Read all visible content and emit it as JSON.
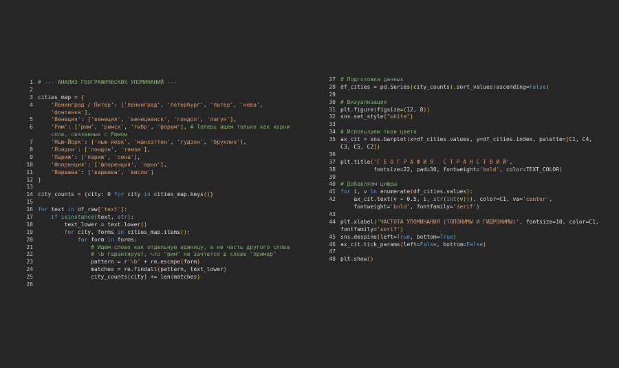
{
  "editor": {
    "left_pane": [
      {
        "n": "1",
        "segs": [
          [
            "c",
            "# --- АНАЛИЗ ГЕОГРАФИЧЕСКИХ УПОМИНАНИЙ ---"
          ]
        ]
      },
      {
        "n": "2",
        "segs": []
      },
      {
        "n": "3",
        "segs": [
          [
            "t",
            "cities_map = "
          ],
          [
            "p",
            "{"
          ]
        ]
      },
      {
        "n": "4",
        "segs": [
          [
            "t",
            "    "
          ],
          [
            "s",
            "'Ленинград / Питер'"
          ],
          [
            "t",
            ": "
          ],
          [
            "p",
            "["
          ],
          [
            "s",
            "'ленинград'"
          ],
          [
            "t",
            ", "
          ],
          [
            "s",
            "'петербург'"
          ],
          [
            "t",
            ", "
          ],
          [
            "s",
            "'питер'"
          ],
          [
            "t",
            ", "
          ],
          [
            "s",
            "'нева'"
          ],
          [
            "t",
            ","
          ]
        ]
      },
      {
        "n": "",
        "segs": [
          [
            "t",
            "    "
          ],
          [
            "s",
            "'фонтанка'"
          ],
          [
            "p",
            "]"
          ],
          [
            "t",
            ","
          ]
        ]
      },
      {
        "n": "5",
        "segs": [
          [
            "t",
            "    "
          ],
          [
            "s",
            "'Венеция'"
          ],
          [
            "t",
            ": "
          ],
          [
            "p",
            "["
          ],
          [
            "s",
            "'венеция'"
          ],
          [
            "t",
            ", "
          ],
          [
            "s",
            "'венецианск'"
          ],
          [
            "t",
            ", "
          ],
          [
            "s",
            "'гондол'"
          ],
          [
            "t",
            ", "
          ],
          [
            "s",
            "'лагун'"
          ],
          [
            "p",
            "]"
          ],
          [
            "t",
            ","
          ]
        ]
      },
      {
        "n": "6",
        "segs": [
          [
            "t",
            "    "
          ],
          [
            "s",
            "'Рим'"
          ],
          [
            "t",
            ": "
          ],
          [
            "p",
            "["
          ],
          [
            "s",
            "'рим'"
          ],
          [
            "t",
            ", "
          ],
          [
            "s",
            "'римск'"
          ],
          [
            "t",
            ", "
          ],
          [
            "s",
            "'тибр'"
          ],
          [
            "t",
            ", "
          ],
          [
            "s",
            "'форум'"
          ],
          [
            "p",
            "]"
          ],
          [
            "t",
            ", "
          ],
          [
            "c",
            "# Теперь ищем только как корни"
          ]
        ]
      },
      {
        "n": "",
        "segs": [
          [
            "t",
            "    "
          ],
          [
            "c",
            "слов, связанных с Римом"
          ]
        ]
      },
      {
        "n": "7",
        "segs": [
          [
            "t",
            "    "
          ],
          [
            "s",
            "'Нью-Йорк'"
          ],
          [
            "t",
            ": "
          ],
          [
            "p",
            "["
          ],
          [
            "s",
            "'нью-йорк'"
          ],
          [
            "t",
            ", "
          ],
          [
            "s",
            "'манхэттен'"
          ],
          [
            "t",
            ", "
          ],
          [
            "s",
            "'гудзон'"
          ],
          [
            "t",
            ", "
          ],
          [
            "s",
            "'бруклин'"
          ],
          [
            "p",
            "]"
          ],
          [
            "t",
            ","
          ]
        ]
      },
      {
        "n": "8",
        "segs": [
          [
            "t",
            "    "
          ],
          [
            "s",
            "'Лондон'"
          ],
          [
            "t",
            ": "
          ],
          [
            "p",
            "["
          ],
          [
            "s",
            "'лондон'"
          ],
          [
            "t",
            ", "
          ],
          [
            "s",
            "'темза'"
          ],
          [
            "p",
            "]"
          ],
          [
            "t",
            ","
          ]
        ]
      },
      {
        "n": "9",
        "segs": [
          [
            "t",
            "    "
          ],
          [
            "s",
            "'Париж'"
          ],
          [
            "t",
            ": "
          ],
          [
            "p",
            "["
          ],
          [
            "s",
            "'париж'"
          ],
          [
            "t",
            ", "
          ],
          [
            "s",
            "'сена'"
          ],
          [
            "p",
            "]"
          ],
          [
            "t",
            ","
          ]
        ]
      },
      {
        "n": "10",
        "segs": [
          [
            "t",
            "    "
          ],
          [
            "s",
            "'Флоренция'"
          ],
          [
            "t",
            ": "
          ],
          [
            "p",
            "["
          ],
          [
            "s",
            "'флоренция'"
          ],
          [
            "t",
            ", "
          ],
          [
            "s",
            "'арно'"
          ],
          [
            "p",
            "]"
          ],
          [
            "t",
            ","
          ]
        ]
      },
      {
        "n": "11",
        "segs": [
          [
            "t",
            "    "
          ],
          [
            "s",
            "'Варшава'"
          ],
          [
            "t",
            ": "
          ],
          [
            "p",
            "["
          ],
          [
            "s",
            "'варшава'"
          ],
          [
            "t",
            ", "
          ],
          [
            "s",
            "'висла'"
          ],
          [
            "p",
            "]"
          ]
        ]
      },
      {
        "n": "12",
        "segs": [
          [
            "p",
            "}"
          ]
        ]
      },
      {
        "n": "13",
        "segs": []
      },
      {
        "n": "14",
        "segs": [
          [
            "t",
            "city_counts = "
          ],
          [
            "p",
            "{"
          ],
          [
            "t",
            "city: 0 "
          ],
          [
            "k",
            "for"
          ],
          [
            "t",
            " city "
          ],
          [
            "k",
            "in"
          ],
          [
            "t",
            " cities_map.keys"
          ],
          [
            "p",
            "()"
          ],
          [
            "p",
            "}"
          ]
        ]
      },
      {
        "n": "15",
        "segs": []
      },
      {
        "n": "16",
        "segs": [
          [
            "k",
            "for"
          ],
          [
            "t",
            " text "
          ],
          [
            "k",
            "in"
          ],
          [
            "t",
            " df_raw"
          ],
          [
            "p",
            "["
          ],
          [
            "s",
            "'text'"
          ],
          [
            "p",
            "]"
          ],
          [
            "t",
            ":"
          ]
        ]
      },
      {
        "n": "17",
        "segs": [
          [
            "t",
            "    "
          ],
          [
            "k",
            "if"
          ],
          [
            "t",
            " "
          ],
          [
            "b",
            "isinstance"
          ],
          [
            "p",
            "("
          ],
          [
            "t",
            "text, "
          ],
          [
            "b",
            "str"
          ],
          [
            "p",
            ")"
          ],
          [
            "t",
            ":"
          ]
        ]
      },
      {
        "n": "18",
        "segs": [
          [
            "t",
            "        text_lower = text.lower"
          ],
          [
            "p",
            "()"
          ]
        ]
      },
      {
        "n": "19",
        "segs": [
          [
            "t",
            "        "
          ],
          [
            "k",
            "for"
          ],
          [
            "t",
            " city, forms "
          ],
          [
            "k",
            "in"
          ],
          [
            "t",
            " cities_map.items"
          ],
          [
            "p",
            "()"
          ],
          [
            "t",
            ":"
          ]
        ]
      },
      {
        "n": "20",
        "segs": [
          [
            "t",
            "            "
          ],
          [
            "k",
            "for"
          ],
          [
            "t",
            " form "
          ],
          [
            "k",
            "in"
          ],
          [
            "t",
            " forms:"
          ]
        ]
      },
      {
        "n": "21",
        "segs": [
          [
            "t",
            "                "
          ],
          [
            "c",
            "# Ищем слово как отдельную единицу, а не часть другого слова"
          ]
        ]
      },
      {
        "n": "22",
        "segs": [
          [
            "t",
            "                "
          ],
          [
            "c",
            "# \\b гарантирует, что \"рим\" не зачтется в слове \"пример\""
          ]
        ]
      },
      {
        "n": "23",
        "segs": [
          [
            "t",
            "                pattern = r"
          ],
          [
            "s",
            "'\\b'"
          ],
          [
            "t",
            " + re.escape"
          ],
          [
            "p",
            "("
          ],
          [
            "t",
            "form"
          ],
          [
            "p",
            ")"
          ]
        ]
      },
      {
        "n": "24",
        "segs": [
          [
            "t",
            "                matches = re.findall"
          ],
          [
            "p",
            "("
          ],
          [
            "t",
            "pattern, text_lower"
          ],
          [
            "p",
            ")"
          ]
        ]
      },
      {
        "n": "25",
        "segs": [
          [
            "t",
            "                city_counts"
          ],
          [
            "p",
            "["
          ],
          [
            "t",
            "city"
          ],
          [
            "p",
            "]"
          ],
          [
            "t",
            " += "
          ],
          [
            "t",
            "len"
          ],
          [
            "p",
            "("
          ],
          [
            "t",
            "matches"
          ],
          [
            "p",
            ")"
          ]
        ]
      },
      {
        "n": "26",
        "segs": []
      }
    ],
    "right_pane": [
      {
        "n": "27",
        "segs": [
          [
            "c",
            "# Подготовка данных"
          ]
        ]
      },
      {
        "n": "28",
        "segs": [
          [
            "t",
            "df_cities = pd.Series"
          ],
          [
            "p",
            "("
          ],
          [
            "t",
            "city_counts"
          ],
          [
            "p",
            ")"
          ],
          [
            "t",
            ".sort_values"
          ],
          [
            "p",
            "("
          ],
          [
            "t",
            "ascending="
          ],
          [
            "v",
            "False"
          ],
          [
            "p",
            ")"
          ]
        ]
      },
      {
        "n": "29",
        "segs": []
      },
      {
        "n": "30",
        "segs": [
          [
            "c",
            "# Визуализация"
          ]
        ]
      },
      {
        "n": "31",
        "segs": [
          [
            "t",
            "plt.figure"
          ],
          [
            "p",
            "("
          ],
          [
            "t",
            "figsize="
          ],
          [
            "p",
            "("
          ],
          [
            "t",
            "12, 8"
          ],
          [
            "p",
            "))"
          ]
        ]
      },
      {
        "n": "32",
        "segs": [
          [
            "t",
            "sns.set_style"
          ],
          [
            "p",
            "("
          ],
          [
            "s",
            "\"white\""
          ],
          [
            "p",
            ")"
          ]
        ]
      },
      {
        "n": "33",
        "segs": []
      },
      {
        "n": "34",
        "segs": [
          [
            "c",
            "# Используем твои цвета"
          ]
        ]
      },
      {
        "n": "35",
        "segs": [
          [
            "t",
            "ax_cit = sns.barplot"
          ],
          [
            "p",
            "("
          ],
          [
            "t",
            "x=df_cities.values, y=df_cities.index, palette="
          ],
          [
            "p",
            "["
          ],
          [
            "t",
            "C1, C4,"
          ]
        ]
      },
      {
        "n": "",
        "segs": [
          [
            "t",
            "C3, C5, C2"
          ],
          [
            "p",
            "])"
          ]
        ]
      },
      {
        "n": "36",
        "segs": []
      },
      {
        "n": "37",
        "segs": [
          [
            "t",
            "plt.title"
          ],
          [
            "p",
            "("
          ],
          [
            "s",
            "'Г Е О Г Р А Ф И Я   С Т Р А Н С Т В И Й'"
          ],
          [
            "t",
            ","
          ]
        ]
      },
      {
        "n": "38",
        "segs": [
          [
            "t",
            "          fontsize=22, pad=30, fontweight="
          ],
          [
            "s",
            "'bold'"
          ],
          [
            "t",
            ", color=TEXT_COLOR"
          ],
          [
            "p",
            ")"
          ]
        ]
      },
      {
        "n": "39",
        "segs": []
      },
      {
        "n": "40",
        "segs": [
          [
            "c",
            "# Добавляем цифры"
          ]
        ]
      },
      {
        "n": "41",
        "segs": [
          [
            "k",
            "for"
          ],
          [
            "t",
            " i, v "
          ],
          [
            "k",
            "in"
          ],
          [
            "t",
            " enumerate"
          ],
          [
            "p",
            "("
          ],
          [
            "t",
            "df_cities.values"
          ],
          [
            "p",
            ")"
          ],
          [
            "t",
            ":"
          ]
        ]
      },
      {
        "n": "42",
        "segs": [
          [
            "t",
            "    ax_cit.text"
          ],
          [
            "p",
            "("
          ],
          [
            "t",
            "v + 0.5, i, "
          ],
          [
            "b",
            "str"
          ],
          [
            "p",
            "("
          ],
          [
            "b",
            "int"
          ],
          [
            "p",
            "("
          ],
          [
            "t",
            "v"
          ],
          [
            "p",
            ")))"
          ],
          [
            "t",
            ", color=C1, va="
          ],
          [
            "s",
            "'center'"
          ],
          [
            "t",
            ","
          ]
        ]
      },
      {
        "n": "",
        "segs": [
          [
            "t",
            "    fontweight="
          ],
          [
            "s",
            "'bold'"
          ],
          [
            "t",
            ", fontfamily="
          ],
          [
            "s",
            "'serif'"
          ],
          [
            "p",
            ")"
          ]
        ]
      },
      {
        "n": "43",
        "segs": []
      },
      {
        "n": "44",
        "segs": [
          [
            "t",
            "plt.xlabel"
          ],
          [
            "p",
            "("
          ],
          [
            "s",
            "'ЧАСТОТА УПОМИНАНИЯ (ТОПОНИМЫ И ГИДРОНИМЫ)'"
          ],
          [
            "t",
            ", fontsize=10, color=C1,"
          ]
        ]
      },
      {
        "n": "",
        "segs": [
          [
            "t",
            "fontfamily="
          ],
          [
            "s",
            "'serif'"
          ],
          [
            "p",
            ")"
          ]
        ]
      },
      {
        "n": "45",
        "segs": [
          [
            "t",
            "sns.despine"
          ],
          [
            "p",
            "("
          ],
          [
            "t",
            "left="
          ],
          [
            "v",
            "True"
          ],
          [
            "t",
            ", bottom="
          ],
          [
            "v",
            "True"
          ],
          [
            "p",
            ")"
          ]
        ]
      },
      {
        "n": "46",
        "segs": [
          [
            "t",
            "ax_cit.tick_params"
          ],
          [
            "p",
            "("
          ],
          [
            "t",
            "left="
          ],
          [
            "v",
            "False"
          ],
          [
            "t",
            ", bottom="
          ],
          [
            "v",
            "False"
          ],
          [
            "p",
            ")"
          ]
        ]
      },
      {
        "n": "47",
        "segs": []
      },
      {
        "n": "48",
        "segs": [
          [
            "t",
            "plt.show"
          ],
          [
            "p",
            "()"
          ]
        ]
      }
    ]
  }
}
